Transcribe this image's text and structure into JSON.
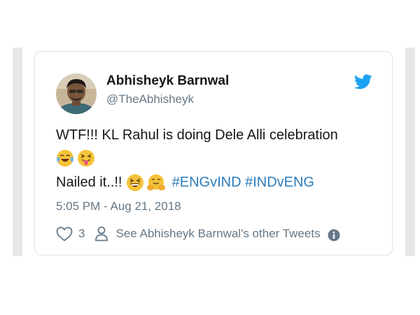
{
  "tweet": {
    "author_name": "Abhisheyk Barnwal",
    "author_handle": "@TheAbhisheyk",
    "text_line1": "WTF!!! KL Rahul is doing Dele Alli celebration",
    "text_line3_prefix": "Nailed it..!!",
    "hashtags": [
      "#ENGvIND",
      "#INDvENG"
    ],
    "timestamp": "5:05 PM - Aug 21, 2018",
    "like_count": "3",
    "other_tweets_label": "See Abhisheyk Barnwal's other Tweets"
  },
  "icons": {
    "brand": "twitter-bird-icon",
    "like": "heart-icon",
    "profile": "person-icon",
    "info": "info-icon"
  },
  "colors": {
    "twitter_blue": "#1da1f2",
    "hashtag": "#2b7bb9",
    "secondary_text": "#657786",
    "primary_text": "#14171a"
  }
}
